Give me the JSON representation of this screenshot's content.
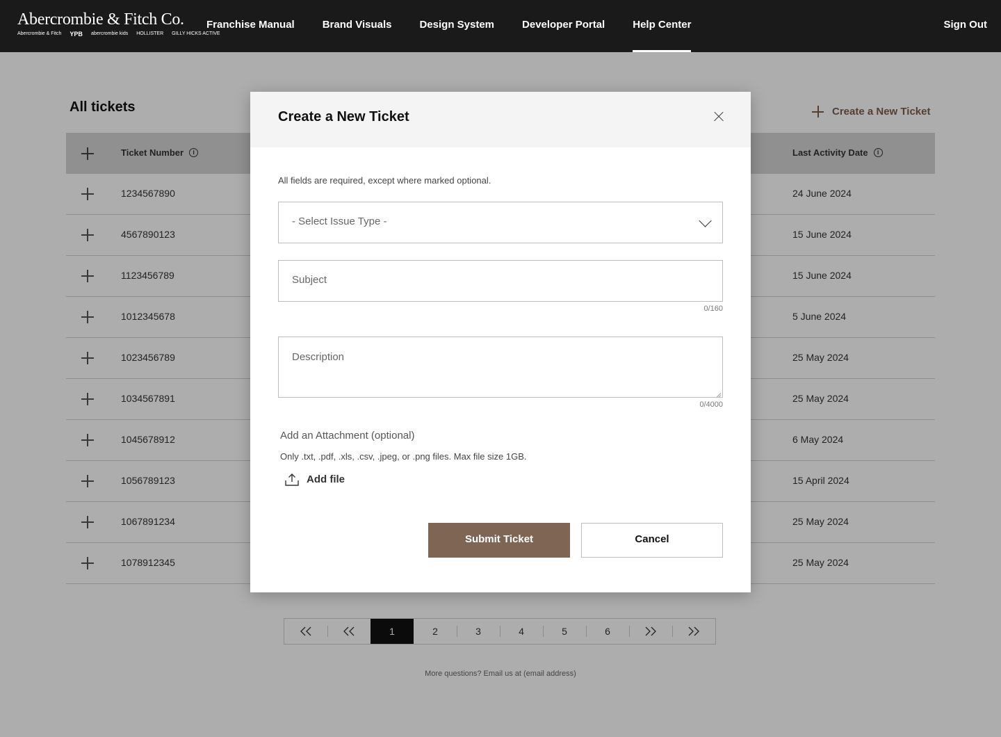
{
  "header": {
    "logo_main": "Abercrombie & Fitch Co.",
    "logo_brands": [
      "Abercrombie & Fitch",
      "YPB",
      "abercrombie kids",
      "HOLLISTER",
      "GILLY HICKS ACTIVE"
    ],
    "nav": [
      "Franchise Manual",
      "Brand Visuals",
      "Design System",
      "Developer Portal",
      "Help Center"
    ],
    "active_nav": "Help Center",
    "sign_out": "Sign Out"
  },
  "page": {
    "title": "All tickets",
    "create_link": "Create a New Ticket",
    "columns": {
      "ticket_number": "Ticket Number",
      "last_activity": "Last Activity Date"
    },
    "rows": [
      {
        "ticket": "1234567890",
        "date": "24 June 2024"
      },
      {
        "ticket": "4567890123",
        "date": "15 June 2024"
      },
      {
        "ticket": "1123456789",
        "date": "15 June 2024"
      },
      {
        "ticket": "1012345678",
        "date": "5 June 2024"
      },
      {
        "ticket": "1023456789",
        "date": "25 May 2024"
      },
      {
        "ticket": "1034567891",
        "date": "25 May 2024"
      },
      {
        "ticket": "1045678912",
        "date": "6 May 2024"
      },
      {
        "ticket": "1056789123",
        "date": "15 April 2024"
      },
      {
        "ticket": "1067891234",
        "date": "25 May 2024"
      },
      {
        "ticket": "1078912345",
        "date": "25 May 2024"
      }
    ],
    "pagination": {
      "first": "«",
      "prev": "«",
      "pages": [
        "1",
        "2",
        "3",
        "4",
        "5",
        "6"
      ],
      "current": "1",
      "next": "»",
      "last": "»"
    },
    "footer_note": "More questions? Email us at (email address)"
  },
  "modal": {
    "title": "Create a New Ticket",
    "required_note": "All fields are required, except where marked optional.",
    "issue_type_placeholder": "- Select Issue Type -",
    "subject_placeholder": "Subject",
    "subject_counter": "0/160",
    "description_placeholder": "Description",
    "description_counter": "0/4000",
    "attachment_title": "Add an Attachment (optional)",
    "attachment_note": "Only .txt, .pdf, .xls, .csv, .jpeg, or .png files. Max file size 1GB.",
    "add_file": "Add file",
    "submit": "Submit Ticket",
    "cancel": "Cancel"
  },
  "colors": {
    "header_bg": "#1a1a1a",
    "accent": "#7f6654",
    "link": "#7d5f4b"
  },
  "icons": [
    "plus-icon",
    "info-icon",
    "close-icon",
    "chevron-down-icon",
    "upload-icon",
    "double-chevron-left-icon",
    "double-chevron-right-icon"
  ]
}
